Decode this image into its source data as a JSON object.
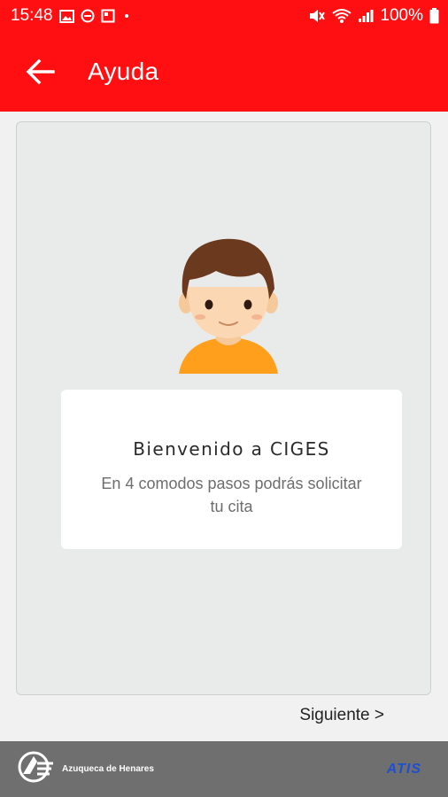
{
  "status_bar": {
    "time": "15:48",
    "battery": "100%",
    "icons_left": [
      "image-icon",
      "dnd-icon",
      "notification-box-icon",
      "dot-icon"
    ],
    "icons_right": [
      "mute-icon",
      "wifi-icon",
      "signal-icon",
      "battery-icon"
    ]
  },
  "app_bar": {
    "title": "Ayuda",
    "back_icon": "arrow-left-icon",
    "color": "#ff0f12"
  },
  "main": {
    "welcome_title": "Bienvenido a CIGES",
    "welcome_subtitle": "En 4 comodos pasos podrás solicitar tu cita",
    "next_label": "Siguiente >"
  },
  "footer": {
    "town_name": "Azuqueca de Henares",
    "brand": "ATIS",
    "brand_color": "#1f4fd1"
  }
}
